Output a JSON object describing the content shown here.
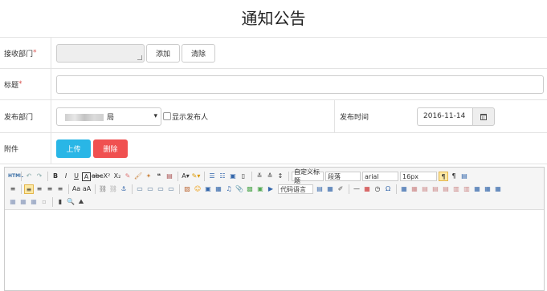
{
  "page": {
    "title": "通知公告"
  },
  "form": {
    "recv_dept": {
      "label": "接收部门",
      "required": "*",
      "add": "添加",
      "clear": "清除"
    },
    "subject": {
      "label": "标题",
      "required": "*"
    },
    "pub_dept": {
      "label": "发布部门",
      "select_value": "局",
      "show_publisher": "显示发布人"
    },
    "pub_time": {
      "label": "发布时间",
      "value": "2016-11-14"
    },
    "attachment": {
      "label": "附件",
      "upload": "上传",
      "delete": "删除"
    }
  },
  "editor": {
    "row1": [
      "html",
      "undo",
      "redo",
      "B",
      "I",
      "U",
      "A",
      "abc",
      "X²",
      "X₂",
      "eraser",
      "brush",
      "brush2",
      "quote",
      "paste",
      "A",
      "color",
      "list-ol",
      "list-ul",
      "line-height",
      "spacing"
    ],
    "heading_select": "自定义标题",
    "para_select": "段落",
    "font_select": "arial",
    "size_select": "16px",
    "code_select": "代码语言",
    "colors": {
      "active": "#fde9a4",
      "blue_button": "#29b6e6",
      "red_button": "#f05050"
    }
  }
}
